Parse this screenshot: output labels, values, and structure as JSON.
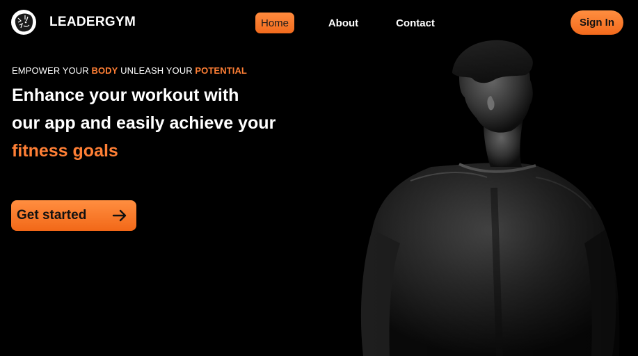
{
  "header": {
    "brand": "LEADERGYM",
    "logo_icon": "lion-icon",
    "nav": [
      {
        "label": "Home",
        "active": true
      },
      {
        "label": "About",
        "active": false
      },
      {
        "label": "Contact",
        "active": false
      }
    ],
    "sign_in_label": "Sign In"
  },
  "hero": {
    "tagline": {
      "part1": "EMPOWER YOUR ",
      "highlight1": "BODY",
      "part2": " UNLEASH YOUR ",
      "highlight2": "POTENTIAL"
    },
    "headline_line1": "Enhance your workout with",
    "headline_line2": "our app and easily achieve your",
    "headline_accent": "fitness goals",
    "cta_label": "Get started",
    "cta_icon": "arrow-right-icon",
    "image_icon": "athlete-back-photo"
  },
  "colors": {
    "accent": "#ff7f35",
    "button_gradient_top": "#ff8e40",
    "button_gradient_bottom": "#f26818",
    "background": "#000000"
  }
}
